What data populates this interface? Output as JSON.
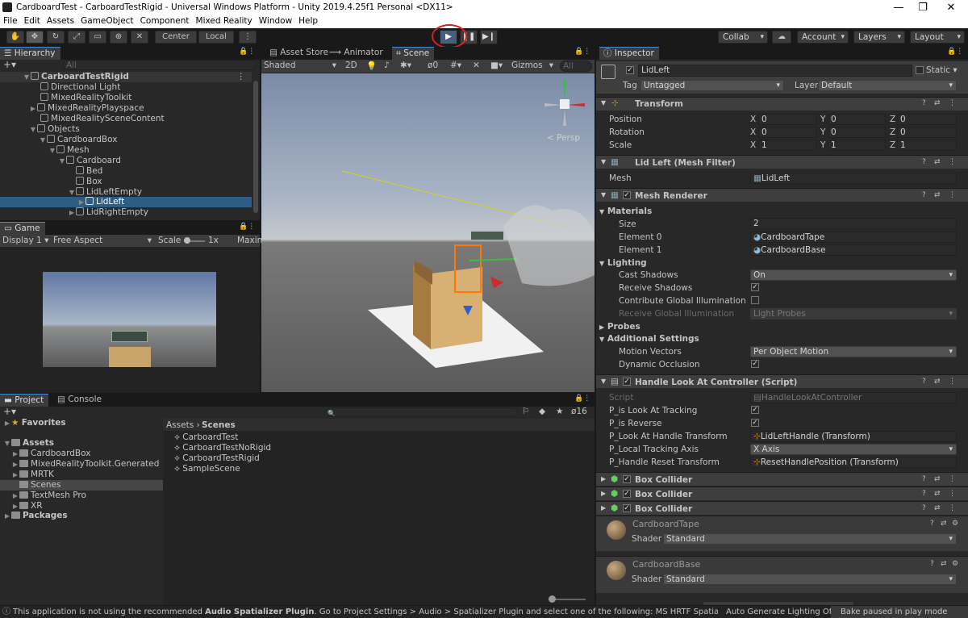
{
  "window": {
    "title": "CardboardTest - CarboardTestRigid - Universal Windows Platform - Unity 2019.4.25f1 Personal <DX11>",
    "controls": [
      "—",
      "❐",
      "✕"
    ]
  },
  "menu": [
    "File",
    "Edit",
    "Assets",
    "GameObject",
    "Component",
    "Mixed Reality",
    "Window",
    "Help"
  ],
  "toolbar": {
    "pivot": "Center",
    "space": "Local",
    "collab": "Collab",
    "account": "Account",
    "layers": "Layers",
    "layout": "Layout"
  },
  "hierarchy": {
    "tab": "Hierarchy",
    "search_placeholder": "All",
    "scene": "CarboardTestRigid",
    "items": [
      {
        "label": "Directional Light"
      },
      {
        "label": "MixedRealityToolkit"
      },
      {
        "label": "MixedRealityPlayspace"
      },
      {
        "label": "MixedRealitySceneContent"
      },
      {
        "label": "Objects"
      },
      {
        "label": "CardboardBox"
      },
      {
        "label": "Mesh"
      },
      {
        "label": "Cardboard"
      },
      {
        "label": "Bed"
      },
      {
        "label": "Box"
      },
      {
        "label": "LidLeftEmpty"
      },
      {
        "label": "LidLeft"
      },
      {
        "label": "LidRightEmpty"
      }
    ]
  },
  "scene": {
    "tabs": [
      "Asset Store",
      "Animator",
      "Scene"
    ],
    "shading": "Shaded",
    "mode2d": "2D",
    "fx_count": "0",
    "gizmos": "Gizmos",
    "search_placeholder": "All",
    "persp": "< Persp"
  },
  "game": {
    "tab": "Game",
    "display": "Display 1",
    "aspect": "Free Aspect",
    "scale_label": "Scale",
    "scale_value": "1x",
    "maximize": "Maxim"
  },
  "project": {
    "tabs": [
      "Project",
      "Console"
    ],
    "favorites": "Favorites",
    "assets": "Assets",
    "folders": [
      "CardboardBox",
      "MixedRealityToolkit.Generated",
      "MRTK",
      "Scenes",
      "TextMesh Pro",
      "XR"
    ],
    "packages": "Packages",
    "breadcrumb": [
      "Assets",
      "Scenes"
    ],
    "files": [
      "CarboardTest",
      "CarboardTestNoRigid",
      "CarboardTestRigid",
      "SampleScene"
    ],
    "hidden_count": "16"
  },
  "inspector": {
    "tab": "Inspector",
    "object_name": "LidLeft",
    "static_label": "Static",
    "tag_label": "Tag",
    "tag_value": "Untagged",
    "layer_label": "Layer",
    "layer_value": "Default",
    "transform": {
      "title": "Transform",
      "rows": [
        {
          "label": "Position",
          "x": "0",
          "y": "0",
          "z": "0"
        },
        {
          "label": "Rotation",
          "x": "0",
          "y": "0",
          "z": "0"
        },
        {
          "label": "Scale",
          "x": "1",
          "y": "1",
          "z": "1"
        }
      ]
    },
    "mesh_filter": {
      "title": "Lid Left (Mesh Filter)",
      "mesh_label": "Mesh",
      "mesh_value": "LidLeft"
    },
    "mesh_renderer": {
      "title": "Mesh Renderer",
      "materials": "Materials",
      "size_label": "Size",
      "size_value": "2",
      "el0_label": "Element 0",
      "el0_value": "CardboardTape",
      "el1_label": "Element 1",
      "el1_value": "CardboardBase",
      "lighting": "Lighting",
      "cast_label": "Cast Shadows",
      "cast_value": "On",
      "receive_label": "Receive Shadows",
      "contrib_label": "Contribute Global Illumination",
      "rgi_label": "Receive Global Illumination",
      "rgi_value": "Light Probes",
      "probes": "Probes",
      "additional": "Additional Settings",
      "motion_label": "Motion Vectors",
      "motion_value": "Per Object Motion",
      "dynamic_label": "Dynamic Occlusion"
    },
    "script": {
      "title": "Handle Look At Controller (Script)",
      "script_label": "Script",
      "script_value": "HandleLookAtController",
      "tracking_label": "P_is Look At Tracking",
      "reverse_label": "P_is Reverse",
      "handle_label": "P_Look At Handle Transform",
      "handle_value": "LidLeftHandle (Transform)",
      "axis_label": "P_Local Tracking Axis",
      "axis_value": "X Axis",
      "reset_label": "P_Handle Reset Transform",
      "reset_value": "ResetHandlePosition (Transform)"
    },
    "colliders": [
      "Box Collider",
      "Box Collider",
      "Box Collider"
    ],
    "materials": [
      {
        "name": "CardboardTape",
        "shader_label": "Shader",
        "shader": "Standard"
      },
      {
        "name": "CardboardBase",
        "shader_label": "Shader",
        "shader": "Standard"
      }
    ]
  },
  "status": {
    "message_pre": "This application is not using the recommended ",
    "message_bold": "Audio Spatializer Plugin",
    "message_post": ". Go to Project Settings > Audio > Spatializer Plugin and select one of the following: MS HRTF Spatializer, Microsoft S",
    "auto_lighting": "Auto Generate Lighting Off",
    "bake": "Bake paused in play mode"
  },
  "colors": {
    "accent": "#4b8bd4",
    "selection": "#2c5d87",
    "highlight_circle": "#d42020"
  }
}
